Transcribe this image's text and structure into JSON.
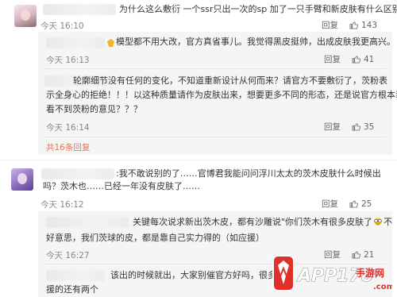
{
  "comments": [
    {
      "text": "为什么这么敷衍 一个ssr只出一次的sp 加了一只手臂和新皮肤有什么区别",
      "time": "今天 16:10",
      "reply": "回复",
      "likes": "143"
    },
    {
      "text": ":我不敢说别的了……官博君我能问问浮川太太的茨木皮肤什么时候出吗？茨木也……已经一年没有皮肤了……",
      "time": "今天 16:12",
      "reply": "回复",
      "likes": "25"
    }
  ],
  "replies_group1": [
    {
      "text": "模型都不用大改，官方真省事儿。我觉得黑皮挺帅，出成皮肤我更高兴。",
      "time": "今天 16:13",
      "reply": "回复",
      "likes": "41"
    },
    {
      "line1": "轮廓细节没有任何的变化，不知道重新设计从何而来？请官方不要敷衍了，茨粉表",
      "line2": "示全身心的拒绝！！！以这种质量请作为皮肤出来，想要更多不同的形态，还是说官方根本装睛",
      "line3": "看不到茨粉的意见？？？",
      "time": "今天 16:14",
      "reply": "回复",
      "likes": "35"
    }
  ],
  "more_replies": "共16条回复",
  "replies_group2": [
    {
      "line1": "关键每次说求新出茨木皮，都有沙雕说\"你们茨木有很多皮肤了",
      "line1b": "不",
      "line2": "好意思，我们茨球的皮，都是靠自己实力得的（如应援）",
      "time": "今天 16:27",
      "reply": "回复",
      "likes": "21"
    },
    {
      "line1": "该出的时候就出，大家别催官方好吗，很多",
      "line2": "援的还有两个"
    }
  ],
  "watermark": {
    "brand": "APP178",
    "sub": "手游网",
    "url": ".com"
  },
  "colors": {
    "more_link": "#eb7350",
    "reply_bg": "#f5f5f5",
    "watermark_red": "#e0302a"
  }
}
